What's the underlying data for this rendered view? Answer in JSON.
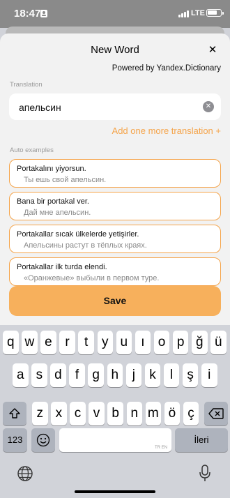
{
  "status_bar": {
    "time": "18:47",
    "network": "LTE"
  },
  "sheet": {
    "title": "New Word",
    "close_label": "✕",
    "powered_by": "Powered by Yandex.Dictionary",
    "translation_label": "Translation",
    "translation_value": "апельсин",
    "add_translation": "Add one more translation +",
    "examples_label": "Auto examples",
    "examples": [
      {
        "source": "Portakalını yiyorsun.",
        "translation": "Ты ешь свой апельсин."
      },
      {
        "source": "Bana bir portakal ver.",
        "translation": "Дай мне апельсин."
      },
      {
        "source": "Portakallar sıcak ülkelerde yetişirler.",
        "translation": "Апельсины растут в тёплых краях."
      },
      {
        "source": "Portakallar ilk turda elendi.",
        "translation": "«Оранжевые» выбыли в первом туре."
      }
    ],
    "save_label": "Save"
  },
  "keyboard": {
    "row1": [
      "q",
      "w",
      "e",
      "r",
      "t",
      "y",
      "u",
      "ı",
      "o",
      "p",
      "ğ",
      "ü"
    ],
    "row2": [
      "a",
      "s",
      "d",
      "f",
      "g",
      "h",
      "j",
      "k",
      "l",
      "ş",
      "i"
    ],
    "row3": [
      "z",
      "x",
      "c",
      "v",
      "b",
      "n",
      "m",
      "ö",
      "ç"
    ],
    "numbers_label": "123",
    "space_hint": "TR EN",
    "return_label": "İleri",
    "accent_color": "#f5a44a"
  }
}
